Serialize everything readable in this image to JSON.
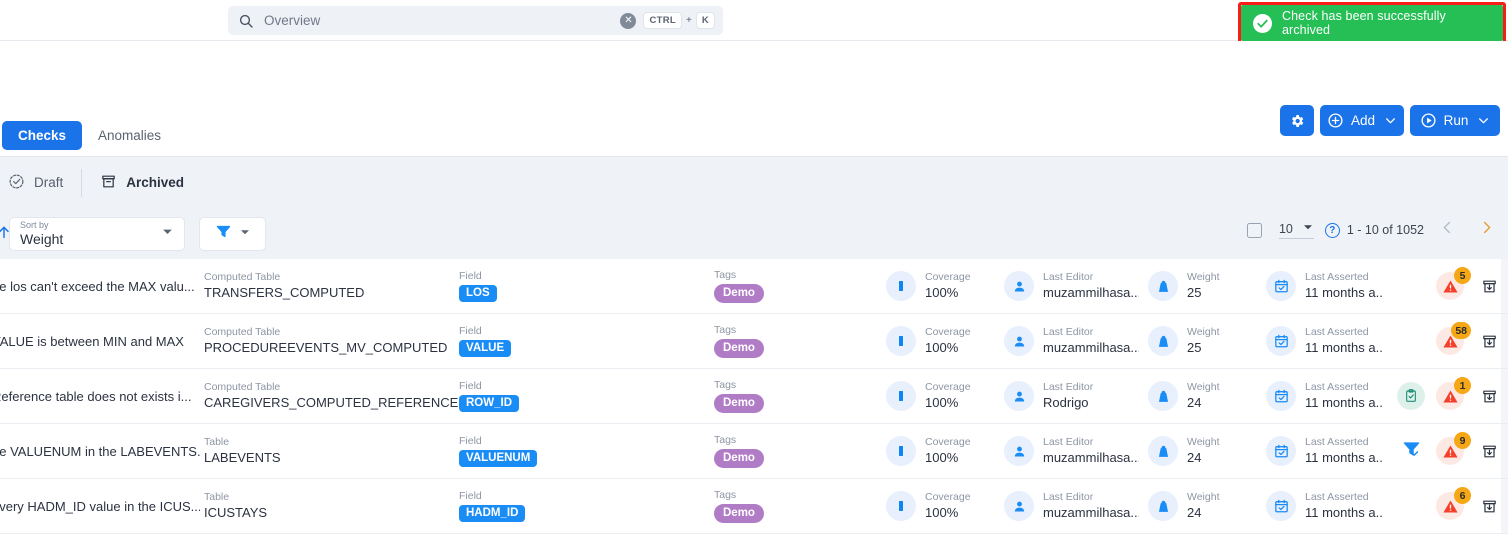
{
  "search": {
    "placeholder": "Overview",
    "value": "",
    "icon": "search-icon",
    "clear_icon": "close-circle-icon",
    "shortcut_key": "CTRL",
    "shortcut_plus": "+",
    "shortcut_key2": "K"
  },
  "toast": {
    "message": "Check has been successfully archived",
    "icon": "check-circle-icon",
    "background": "#26bf55",
    "highlight_border": "#f81d17"
  },
  "toolbar": {
    "gear_icon": "gear-icon",
    "add_label": "Add",
    "add_icon": "plus-circle-icon",
    "run_label": "Run",
    "run_icon": "play-circle-icon",
    "caret_icon": "chevron-down-icon",
    "accent": "#1a73e8"
  },
  "tabs": [
    {
      "label": "Checks",
      "active": true
    },
    {
      "label": "Anomalies",
      "active": false
    }
  ],
  "subtabs": [
    {
      "label": "Draft",
      "icon": "draft-check-icon",
      "active": false
    },
    {
      "label": "Archived",
      "icon": "archive-box-icon",
      "active": true
    }
  ],
  "sort": {
    "caption": "Sort by",
    "value": "Weight",
    "direction_icon": "sort-ascending-arrow-icon",
    "caret_icon": "caret-down-icon"
  },
  "filter": {
    "icon": "funnel-icon",
    "caret_icon": "caret-down-icon"
  },
  "pagination": {
    "select_all_icon": "checkbox-unchecked-icon",
    "page_size": "10",
    "page_size_caret": "caret-down-icon",
    "help_icon": "question-circle-icon",
    "help_label": "?",
    "range": "1 - 10 of 1052",
    "prev_icon": "chevron-left-icon",
    "next_icon": "chevron-right-icon"
  },
  "columns": {
    "table_caption_computed": "Computed Table",
    "table_caption_plain": "Table",
    "field_caption": "Field",
    "tags_caption": "Tags",
    "coverage_caption": "Coverage",
    "editor_caption": "Last Editor",
    "weight_caption": "Weight",
    "asserted_caption": "Last Asserted"
  },
  "rows": [
    {
      "name": "he los can't exceed the MAX valu...",
      "table_caption": "Computed Table",
      "table": "TRANSFERS_COMPUTED",
      "field_caption": "Field",
      "field": "LOS",
      "tags_caption": "Tags",
      "tag": "Demo",
      "coverage_caption": "Coverage",
      "coverage": "100%",
      "editor_caption": "Last Editor",
      "editor": "muzammilhasa...",
      "weight_caption": "Weight",
      "weight": "25",
      "asserted_caption": "Last Asserted",
      "asserted": "11 months a..",
      "alerts": "5",
      "extra_icon": "",
      "unarchive_icon": "unarchive-icon"
    },
    {
      "name": "VALUE is between MIN and MAX",
      "table_caption": "Computed Table",
      "table": "PROCEDUREEVENTS_MV_COMPUTED",
      "field_caption": "Field",
      "field": "VALUE",
      "tags_caption": "Tags",
      "tag": "Demo",
      "coverage_caption": "Coverage",
      "coverage": "100%",
      "editor_caption": "Last Editor",
      "editor": "muzammilhasa...",
      "weight_caption": "Weight",
      "weight": "25",
      "asserted_caption": "Last Asserted",
      "asserted": "11 months a..",
      "alerts": "58",
      "extra_icon": "",
      "unarchive_icon": "unarchive-icon"
    },
    {
      "name": "Reference table does not exists i...",
      "table_caption": "Computed Table",
      "table": "CAREGIVERS_COMPUTED_REFERENCE",
      "field_caption": "Field",
      "field": "ROW_ID",
      "tags_caption": "Tags",
      "tag": "Demo",
      "coverage_caption": "Coverage",
      "coverage": "100%",
      "editor_caption": "Last Editor",
      "editor": "Rodrigo",
      "weight_caption": "Weight",
      "weight": "24",
      "asserted_caption": "Last Asserted",
      "asserted": "11 months a..",
      "alerts": "1",
      "extra_icon": "clipboard-check-icon",
      "unarchive_icon": "unarchive-icon"
    },
    {
      "name": "he VALUENUM in the LABEVENTS...",
      "table_caption": "Table",
      "table": "LABEVENTS",
      "field_caption": "Field",
      "field": "VALUENUM",
      "tags_caption": "Tags",
      "tag": "Demo",
      "coverage_caption": "Coverage",
      "coverage": "100%",
      "editor_caption": "Last Editor",
      "editor": "muzammilhasa...",
      "weight_caption": "Weight",
      "weight": "24",
      "asserted_caption": "Last Asserted",
      "asserted": "11 months a..",
      "alerts": "9",
      "extra_icon": "filter-check-icon",
      "unarchive_icon": "unarchive-icon"
    },
    {
      "name": "every HADM_ID value in the ICUS...",
      "table_caption": "Table",
      "table": "ICUSTAYS",
      "field_caption": "Field",
      "field": "HADM_ID",
      "tags_caption": "Tags",
      "tag": "Demo",
      "coverage_caption": "Coverage",
      "coverage": "100%",
      "editor_caption": "Last Editor",
      "editor": "muzammilhasa...",
      "weight_caption": "Weight",
      "weight": "24",
      "asserted_caption": "Last Asserted",
      "asserted": "11 months a..",
      "alerts": "6",
      "extra_icon": "",
      "unarchive_icon": "unarchive-icon"
    }
  ]
}
